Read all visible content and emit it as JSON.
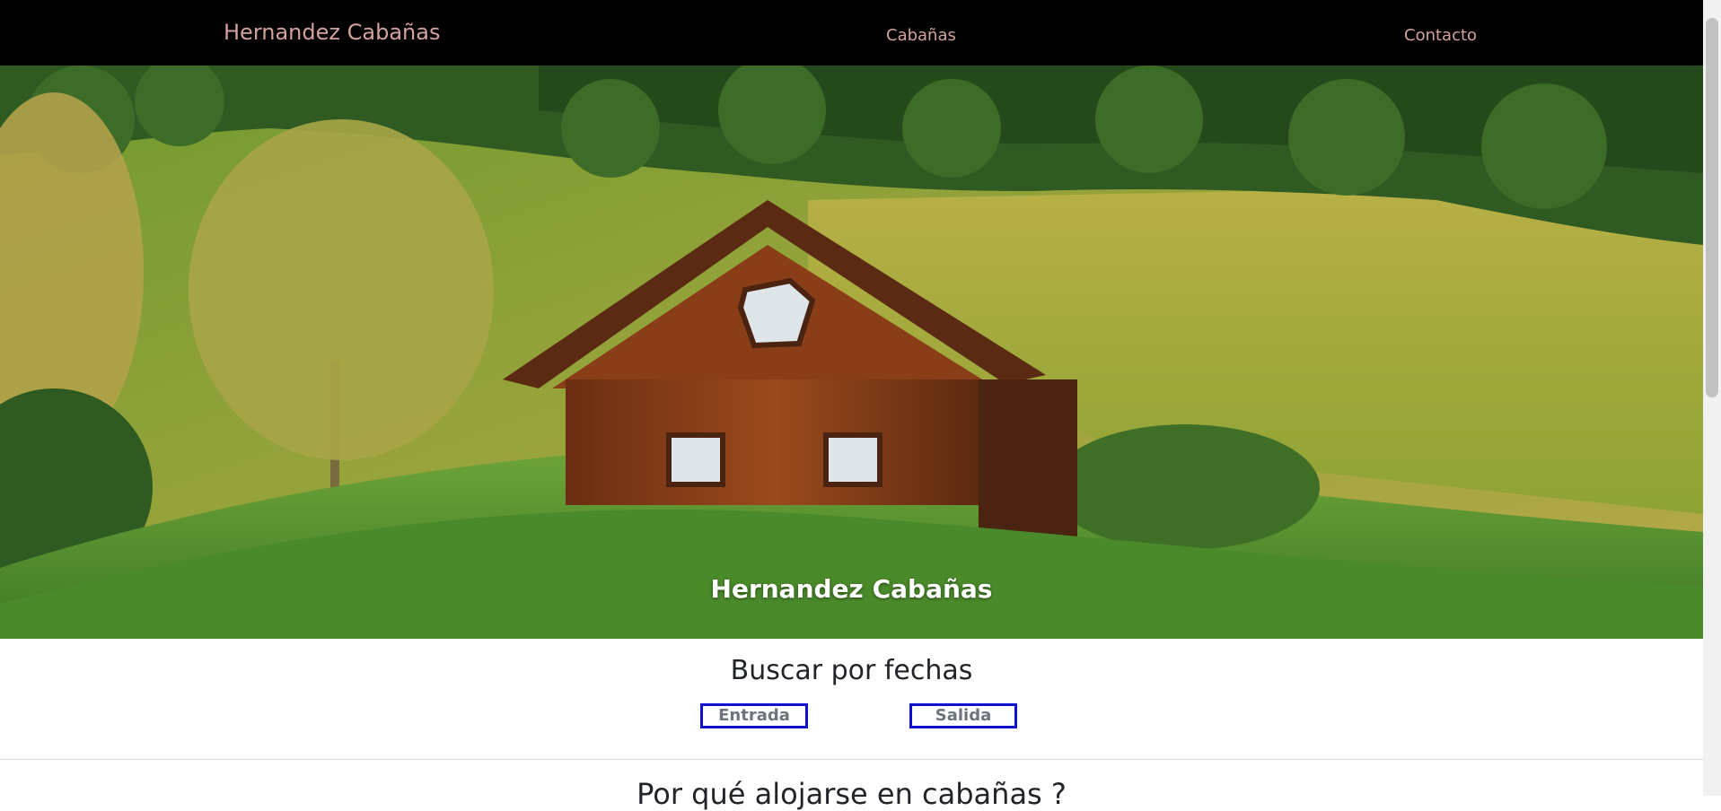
{
  "navbar": {
    "brand": "Hernandez Cabañas",
    "links": [
      "Cabañas",
      "Contacto"
    ]
  },
  "hero": {
    "title": "Hernandez Cabañas",
    "image_icon": "cabin-landscape-image"
  },
  "search": {
    "title": "Buscar por fechas",
    "entrada": "Entrada",
    "salida": "Salida"
  },
  "next_section": {
    "title": "Por qué alojarse en cabañas ?"
  },
  "colors": {
    "nav_bg": "#000000",
    "nav_text": "#d4a29c",
    "button_border": "#1010d0"
  }
}
